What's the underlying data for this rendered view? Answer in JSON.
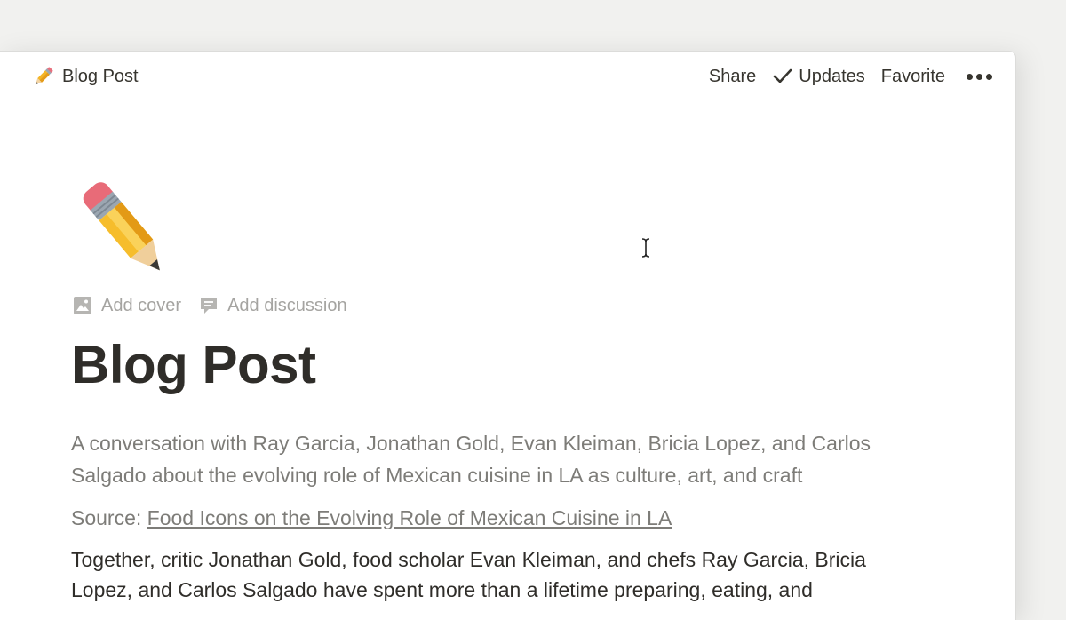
{
  "topbar": {
    "breadcrumb_icon": "pencil-icon",
    "breadcrumb_label": "Blog Post",
    "share_label": "Share",
    "updates_label": "Updates",
    "favorite_label": "Favorite",
    "more_icon": "more-dots-icon"
  },
  "page": {
    "icon": "pencil-icon",
    "add_cover_label": "Add cover",
    "add_discussion_label": "Add discussion",
    "title": "Blog Post",
    "subtitle": "A conversation with Ray Garcia, Jonathan Gold, Evan Kleiman, Bricia Lopez, and Carlos Salgado about the evolving role of Mexican cuisine in LA as culture, art, and craft",
    "source_prefix": "Source: ",
    "source_link": "Food Icons on the Evolving Role of Mexican Cuisine in LA",
    "body": "Together, critic Jonathan Gold, food scholar Evan Kleiman, and chefs Ray Garcia, Bricia Lopez, and Carlos Salgado have spent more than a lifetime preparing, eating, and"
  },
  "colors": {
    "text_primary": "#2f2d29",
    "text_secondary": "#7d7c78",
    "text_muted": "#a5a4a1",
    "background": "#ffffff",
    "desktop": "#f1f1ef"
  }
}
